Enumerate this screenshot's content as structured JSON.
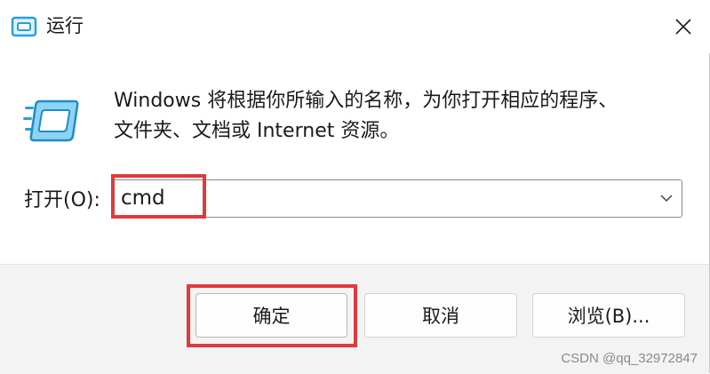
{
  "window": {
    "title": "运行",
    "title_icon": "run-dialog-icon",
    "close_icon": "close-icon"
  },
  "message": {
    "line1": "Windows 将根据你所输入的名称，为你打开相应的程序、",
    "line2": "文件夹、文档或 Internet 资源。"
  },
  "open": {
    "label": "打开(O):",
    "value": "cmd",
    "dropdown_icon": "chevron-down-icon"
  },
  "buttons": {
    "ok": "确定",
    "cancel": "取消",
    "browse": "浏览(B)..."
  },
  "watermark": "CSDN @qq_32972847",
  "colors": {
    "highlight": "#e0393c",
    "icon_blue": "#2a9fd8",
    "footer_bg": "#f3f3f3"
  }
}
